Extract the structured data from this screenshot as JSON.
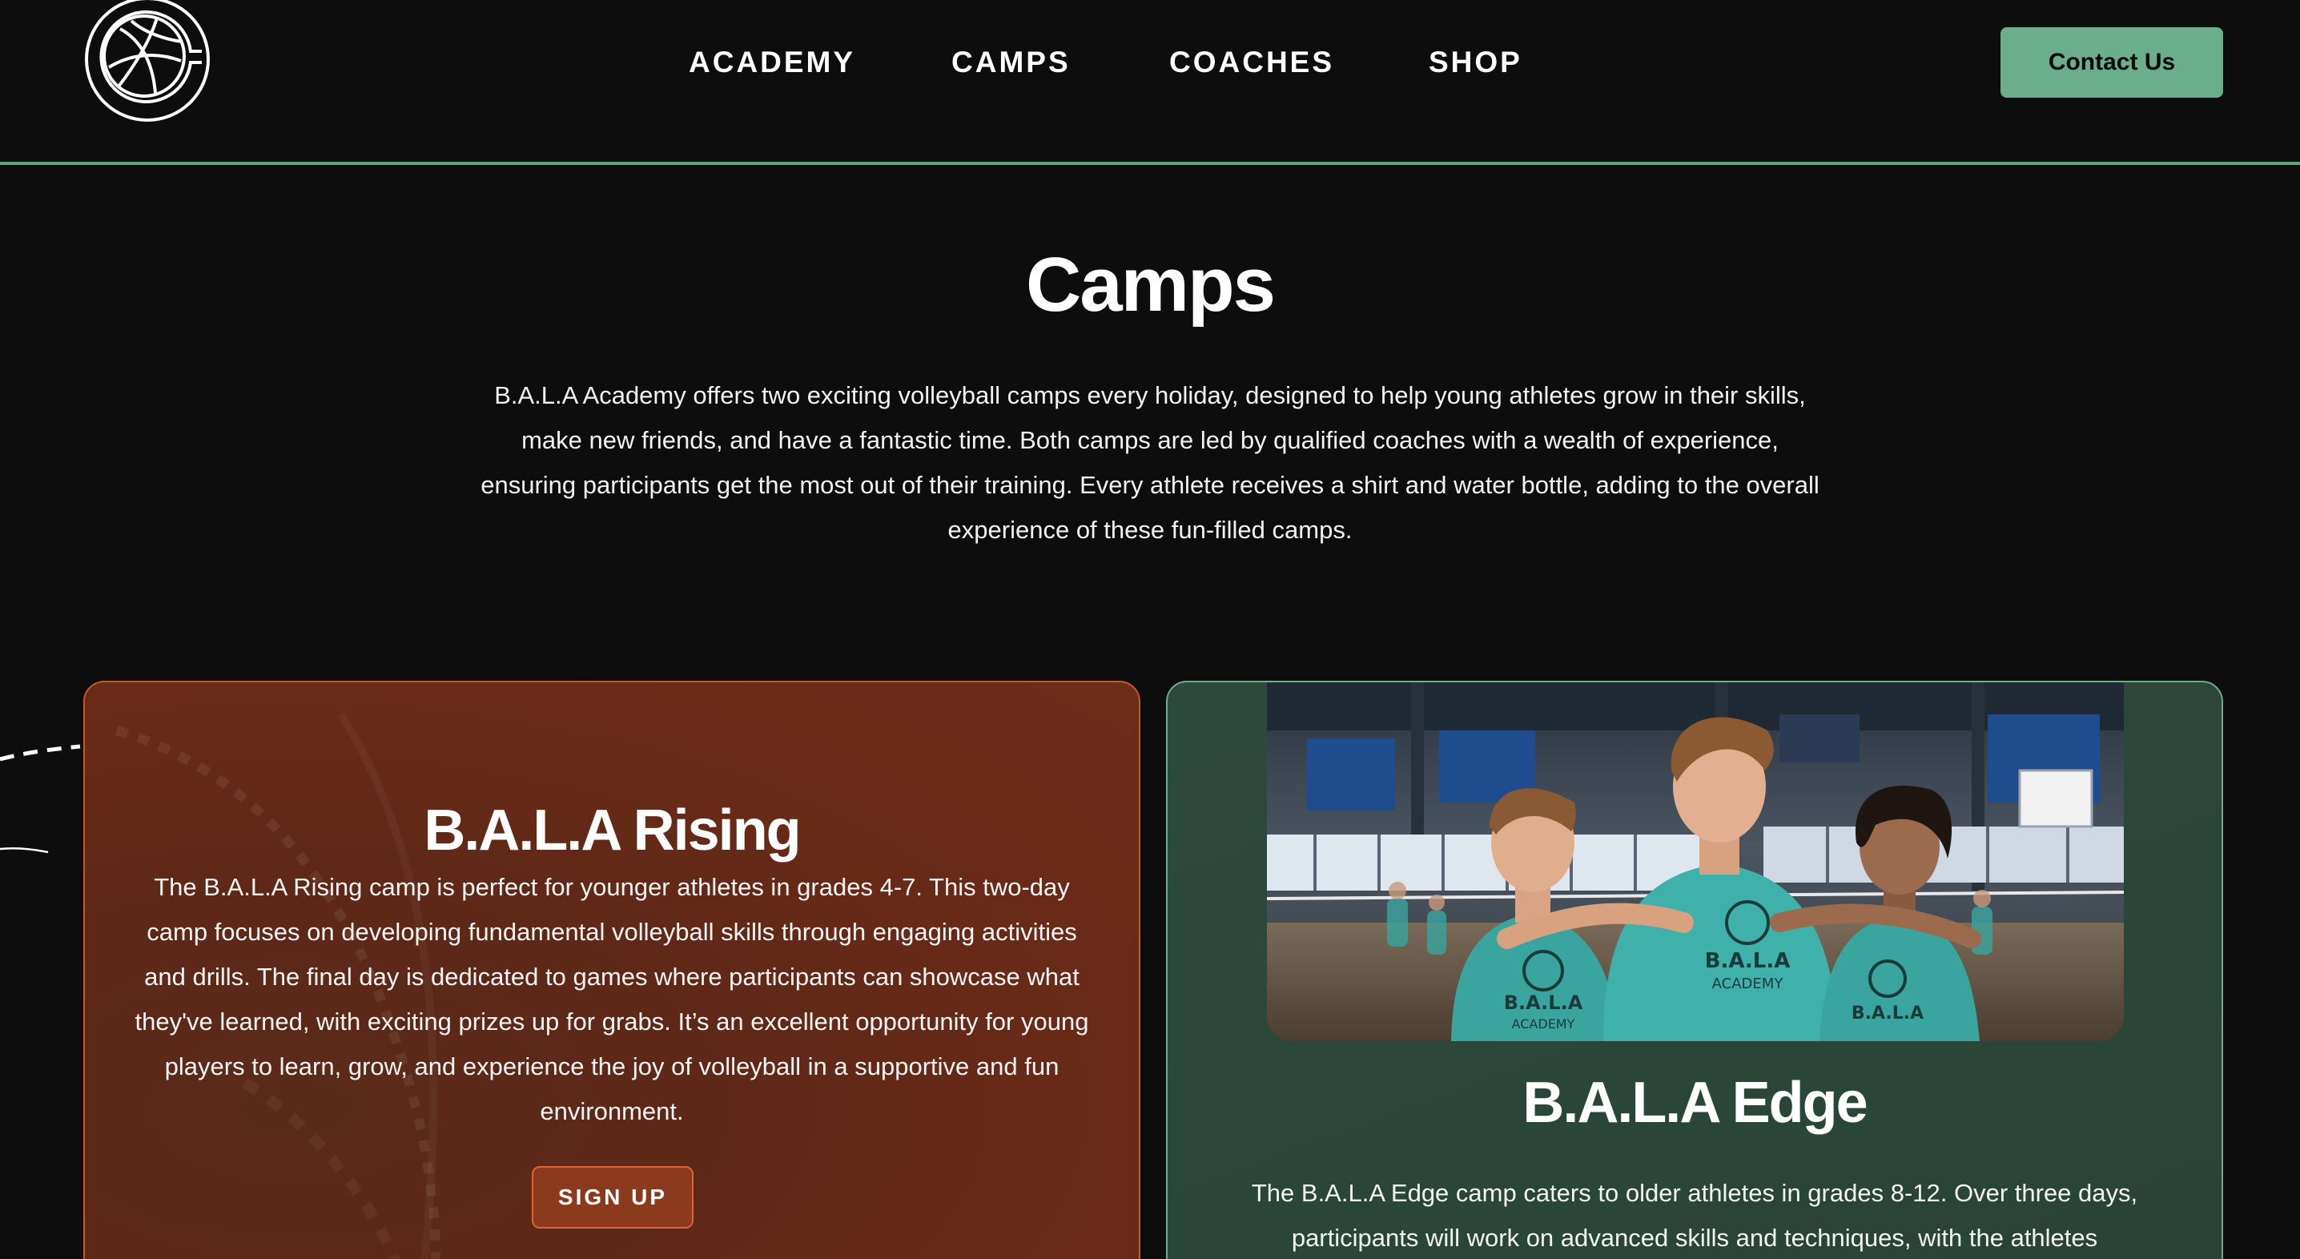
{
  "header": {
    "nav": [
      {
        "label": "ACADEMY"
      },
      {
        "label": "CAMPS"
      },
      {
        "label": "COACHES"
      },
      {
        "label": "SHOP"
      }
    ],
    "contact_label": "Contact Us"
  },
  "intro": {
    "title": "Camps",
    "text": "B.A.L.A Academy offers two exciting volleyball camps every holiday, designed to help young athletes grow in their skills, make new friends, and have a fantastic time. Both camps are led by qualified coaches with a wealth of experience, ensuring participants get the most out of their training. Every athlete receives a shirt and water bottle, adding to the overall experience of these fun-filled camps."
  },
  "cards": {
    "rising": {
      "title": "B.A.L.A Rising",
      "description": "The B.A.L.A Rising camp is perfect for younger athletes in grades 4-7. This two-day camp focuses on developing fundamental volleyball skills through engaging activities and drills. The final day is dedicated to games where participants can showcase what they've learned, with exciting prizes up for grabs. It’s an excellent opportunity for young players to learn, grow, and experience the joy of volleyball in a supportive and fun environment.",
      "button_label": "SIGN UP"
    },
    "edge": {
      "title": "B.A.L.A Edge",
      "description": "The B.A.L.A Edge camp caters to older athletes in grades 8-12. Over three days, participants will work on advanced skills and techniques, with the athletes",
      "shirt_print": [
        "B.A.L.A",
        "ACADEMY"
      ]
    }
  },
  "colors": {
    "background": "#0d0d0d",
    "accent_green": "#6aae8d",
    "rising_border": "#c8562b",
    "rising_bg": "#692b17",
    "edge_bg": "#2a4638",
    "shirt_teal": "#3aa59f"
  },
  "icons": {
    "logo": "volleyball-logo-icon"
  }
}
